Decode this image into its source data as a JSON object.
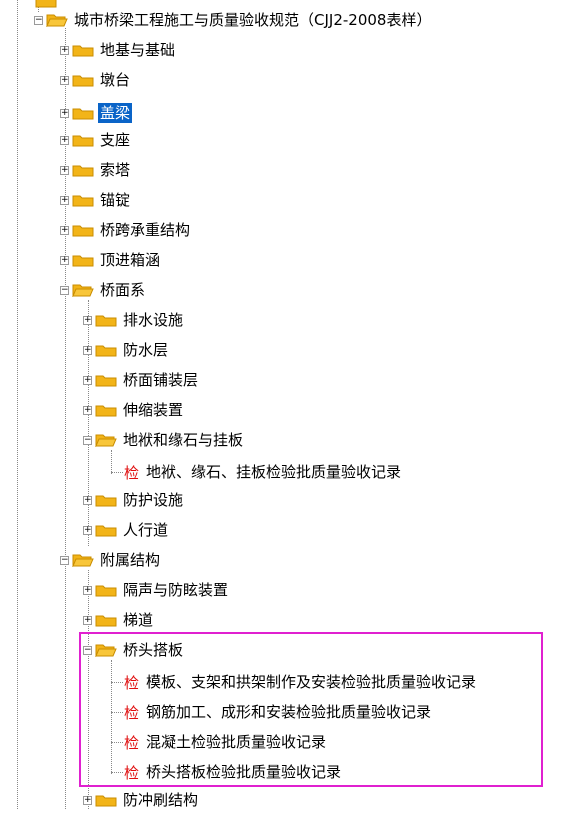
{
  "root": {
    "label": "城市桥梁工程施工与质量验收规范（CJJ2-2008表样）"
  },
  "level1": [
    {
      "label": "地基与基础",
      "state": "collapsed"
    },
    {
      "label": "墩台",
      "state": "collapsed"
    },
    {
      "label": "盖梁",
      "state": "collapsed",
      "selected": true
    },
    {
      "label": "支座",
      "state": "collapsed"
    },
    {
      "label": "索塔",
      "state": "collapsed"
    },
    {
      "label": "锚锭",
      "state": "collapsed"
    },
    {
      "label": "桥跨承重结构",
      "state": "collapsed"
    },
    {
      "label": "顶进箱涵",
      "state": "collapsed"
    },
    {
      "label": "桥面系",
      "state": "expanded"
    },
    {
      "label": "附属结构",
      "state": "expanded"
    }
  ],
  "bridge_deck": [
    {
      "label": "排水设施"
    },
    {
      "label": "防水层"
    },
    {
      "label": "桥面铺装层"
    },
    {
      "label": "伸缩装置"
    },
    {
      "label": "地袱和缘石与挂板"
    },
    {
      "label": "防护设施"
    },
    {
      "label": "人行道"
    }
  ],
  "curb_record": {
    "label": "地袱、缘石、挂板检验批质量验收记录"
  },
  "ancillary": [
    {
      "label": "隔声与防眩装置"
    },
    {
      "label": "梯道"
    },
    {
      "label": "桥头搭板"
    },
    {
      "label": "防冲刷结构"
    }
  ],
  "approach_slab_records": [
    {
      "label": "模板、支架和拱架制作及安装检验批质量验收记录"
    },
    {
      "label": "钢筋加工、成形和安装检验批质量验收记录"
    },
    {
      "label": "混凝土检验批质量验收记录"
    },
    {
      "label": "桥头搭板检验批质量验收记录"
    }
  ],
  "record_icon_text": "检",
  "colors": {
    "selection": "#0a64c8",
    "highlight_border": "#e020d0",
    "record_icon": "#e01010",
    "folder": "#f2b418"
  }
}
